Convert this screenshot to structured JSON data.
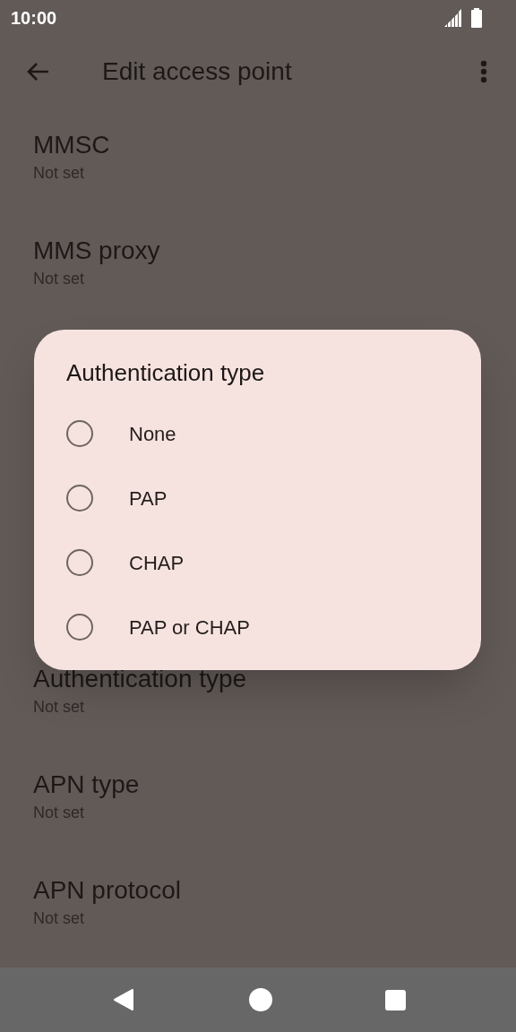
{
  "status_bar": {
    "time": "10:00"
  },
  "app_bar": {
    "title": "Edit access point"
  },
  "settings_above": [
    {
      "title": "MMSC",
      "summary": "Not set"
    },
    {
      "title": "MMS proxy",
      "summary": "Not set"
    }
  ],
  "settings_below": [
    {
      "title": "Authentication type",
      "summary": "Not set"
    },
    {
      "title": "APN type",
      "summary": "Not set"
    },
    {
      "title": "APN protocol",
      "summary": "Not set"
    }
  ],
  "dialog": {
    "title": "Authentication type",
    "options": [
      {
        "label": "None",
        "selected": false
      },
      {
        "label": "PAP",
        "selected": false
      },
      {
        "label": "CHAP",
        "selected": false
      },
      {
        "label": "PAP or CHAP",
        "selected": false
      }
    ]
  }
}
